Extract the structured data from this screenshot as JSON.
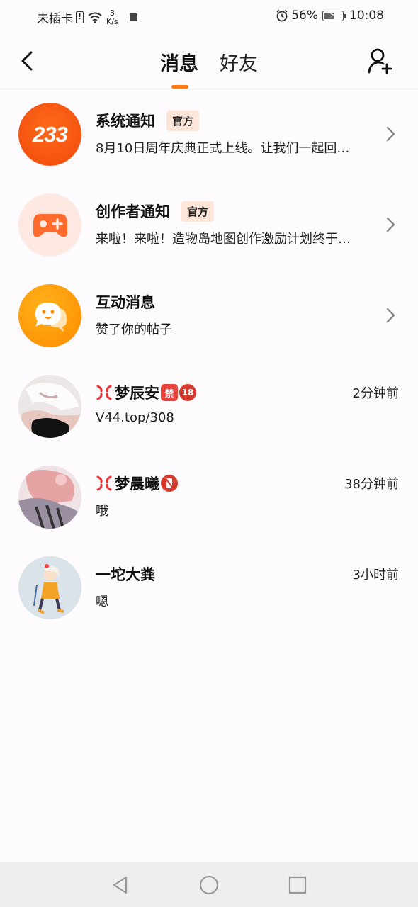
{
  "status_bar": {
    "sim_text": "未插卡",
    "sim_badge": "!",
    "speed_value": "3",
    "speed_unit": "K/s",
    "battery_percent": "56%",
    "time": "10:08"
  },
  "header": {
    "tabs": [
      {
        "label": "消息",
        "active": true
      },
      {
        "label": "好友",
        "active": false
      }
    ]
  },
  "messages": [
    {
      "title": "系统通知",
      "official": "官方",
      "preview": "8月10日周年庆典正式上线。让我们一起回…",
      "avatar_text": "233",
      "icon": "233-logo-icon"
    },
    {
      "title": "创作者通知",
      "official": "官方",
      "preview": "来啦！来啦！造物岛地图创作激励计划终于…",
      "icon": "gamepad-icon"
    },
    {
      "title": "互动消息",
      "preview": "赞了你的帖子",
      "icon": "chat-bubble-icon"
    },
    {
      "title": "梦辰安",
      "badge1": "禁",
      "badge2": "18",
      "time": "2分钟前",
      "preview": "V44.top/308"
    },
    {
      "title": "梦晨曦",
      "time": "38分钟前",
      "preview": "哦"
    },
    {
      "title": "一坨大粪",
      "time": "3小时前",
      "preview": "嗯"
    }
  ],
  "colors": {
    "accent": "#ff7a1a",
    "official_bg": "#fde5d8"
  }
}
